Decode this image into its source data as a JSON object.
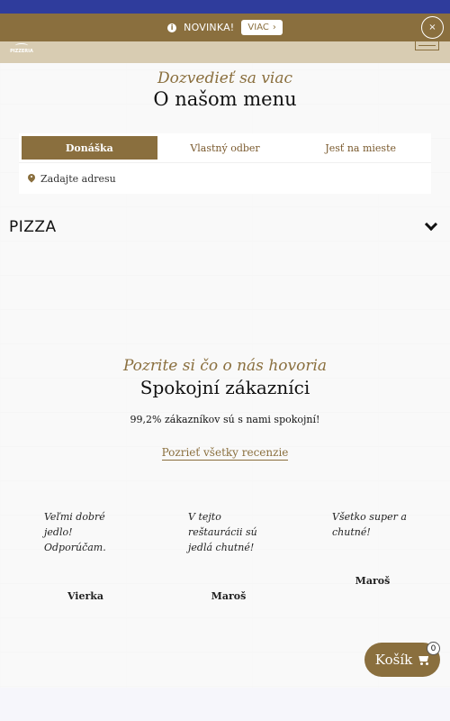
{
  "notice": {
    "text": "NOVINKA!",
    "more_label": "VIAC",
    "more_icon": "chevron-right-icon",
    "close_label": "×"
  },
  "logo": {
    "text": "PIZZERIA"
  },
  "intro": {
    "script": "Dozvedieť sa viac",
    "title": "O našom menu"
  },
  "order_tabs": [
    {
      "label": "Donáška",
      "active": true
    },
    {
      "label": "Vlastný odber",
      "active": false
    },
    {
      "label": "Jesť na mieste",
      "active": false
    }
  ],
  "address": {
    "placeholder": "Zadajte adresu"
  },
  "category": {
    "label": "PIZZA"
  },
  "customers": {
    "script": "Pozrite si čo o nás hovoria",
    "title": "Spokojní zákazníci",
    "satisfaction": "99,2% zákazníkov sú s nami spokojní!",
    "all_reviews": "Pozrieť všetky recenzie"
  },
  "reviews": [
    {
      "text_lines": [
        "Veľmi dobré",
        "jedlo!",
        "Odporúčam."
      ],
      "author": "Vierka"
    },
    {
      "text_lines": [
        "V tejto",
        "reštaurácii sú",
        "jedlá chutné!"
      ],
      "author": "Maroš"
    },
    {
      "text_lines": [
        "Všetko super a",
        "chutné!"
      ],
      "author": "Maroš"
    }
  ],
  "cart": {
    "label": "Košík",
    "count": "0"
  },
  "colors": {
    "accent": "#8a6f3e",
    "top_bar": "#2f3c9c",
    "header": "#d8ccb2"
  }
}
